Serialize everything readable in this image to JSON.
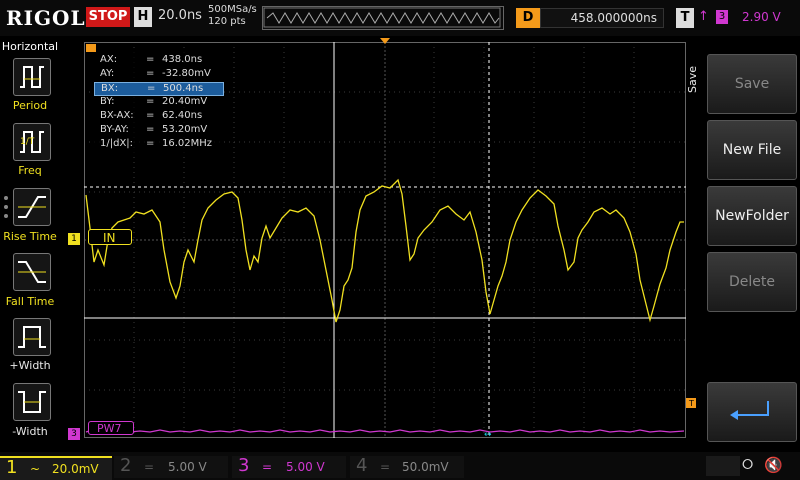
{
  "top": {
    "logo": "RIGOL",
    "run_state": "STOP",
    "h_label": "H",
    "timebase": "20.0ns",
    "sample_rate": "500MSa/s",
    "mem_depth": "120 pts",
    "delay_label": "D",
    "delay_value": "458.000000ns",
    "trigger_label": "T",
    "trigger_source": "3",
    "trigger_level": "2.90 V"
  },
  "left_panel": {
    "title": "Horizontal",
    "items": [
      {
        "label": "Period"
      },
      {
        "label": "Freq"
      },
      {
        "label": "Rise Time"
      },
      {
        "label": "Fall Time"
      },
      {
        "label": "+Width"
      },
      {
        "label": "-Width"
      }
    ]
  },
  "right_panel": {
    "menu_title": "Save",
    "buttons": [
      {
        "label": "Save",
        "enabled": false
      },
      {
        "label": "New File",
        "enabled": true
      },
      {
        "label": "NewFolder",
        "enabled": true
      },
      {
        "label": "Delete",
        "enabled": false
      }
    ]
  },
  "measurements": [
    {
      "key": "AX:",
      "eq": "=",
      "value": "438.0ns",
      "selected": false
    },
    {
      "key": "AY:",
      "eq": "=",
      "value": "-32.80mV",
      "selected": false
    },
    {
      "key": "BX:",
      "eq": "=",
      "value": "500.4ns",
      "selected": true
    },
    {
      "key": "BY:",
      "eq": "=",
      "value": "20.40mV",
      "selected": false
    },
    {
      "key": "BX-AX:",
      "eq": "=",
      "value": "62.40ns",
      "selected": false
    },
    {
      "key": "BY-AY:",
      "eq": "=",
      "value": "53.20mV",
      "selected": false
    },
    {
      "key": "1/|dX|:",
      "eq": "=",
      "value": "16.02MHz",
      "selected": false
    }
  ],
  "traces": {
    "in_label": "IN",
    "in_marker": "1",
    "pw_label": "PW7",
    "pw_marker": "3"
  },
  "channels": [
    {
      "num": "1",
      "coupling": "~",
      "scale": "20.0mV",
      "color": "#f0e020",
      "active": true
    },
    {
      "num": "2",
      "coupling": "=",
      "scale": "5.00 V",
      "color": "#19c8d8",
      "active": false
    },
    {
      "num": "3",
      "coupling": "=",
      "scale": "5.00 V",
      "color": "#d038d0",
      "active": false
    },
    {
      "num": "4",
      "coupling": "=",
      "scale": "50.0mV",
      "color": "#3878e8",
      "active": false
    }
  ],
  "colors": {
    "ch1": "#f0e020",
    "ch3": "#d038d0",
    "delay_accent": "#f49a1a",
    "stop_red": "#d01818",
    "selected_row": "#1c5c9c"
  }
}
